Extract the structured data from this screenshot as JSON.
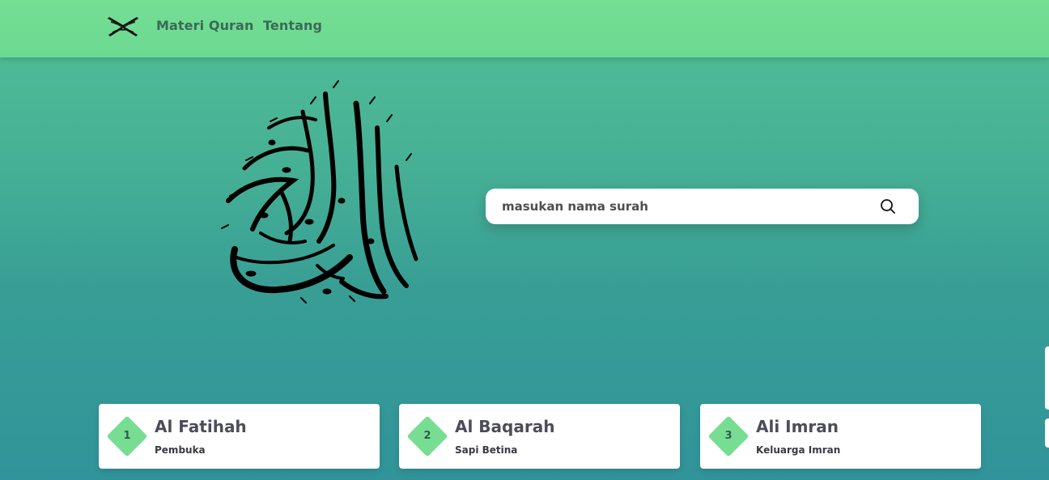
{
  "nav": {
    "logo_icon": "open-quran-book-icon",
    "links": [
      {
        "label": "Materi Quran"
      },
      {
        "label": "Tentang"
      }
    ]
  },
  "hero": {
    "calligraphy_icon": "al-quran-al-karim-calligraphy"
  },
  "search": {
    "placeholder": "masukan nama surah",
    "value": "",
    "icon": "search-icon"
  },
  "surahs": [
    {
      "number": "1",
      "name": "Al Fatihah",
      "meaning": "Pembuka"
    },
    {
      "number": "2",
      "name": "Al Baqarah",
      "meaning": "Sapi Betina"
    },
    {
      "number": "3",
      "name": "Ali Imran",
      "meaning": "Keluarga Imran"
    }
  ],
  "colors": {
    "nav_bg": "#74de93",
    "bg_top": "#53bf95",
    "bg_bottom": "#31949a",
    "badge": "#77dd93",
    "card_bg": "#ffffff"
  }
}
